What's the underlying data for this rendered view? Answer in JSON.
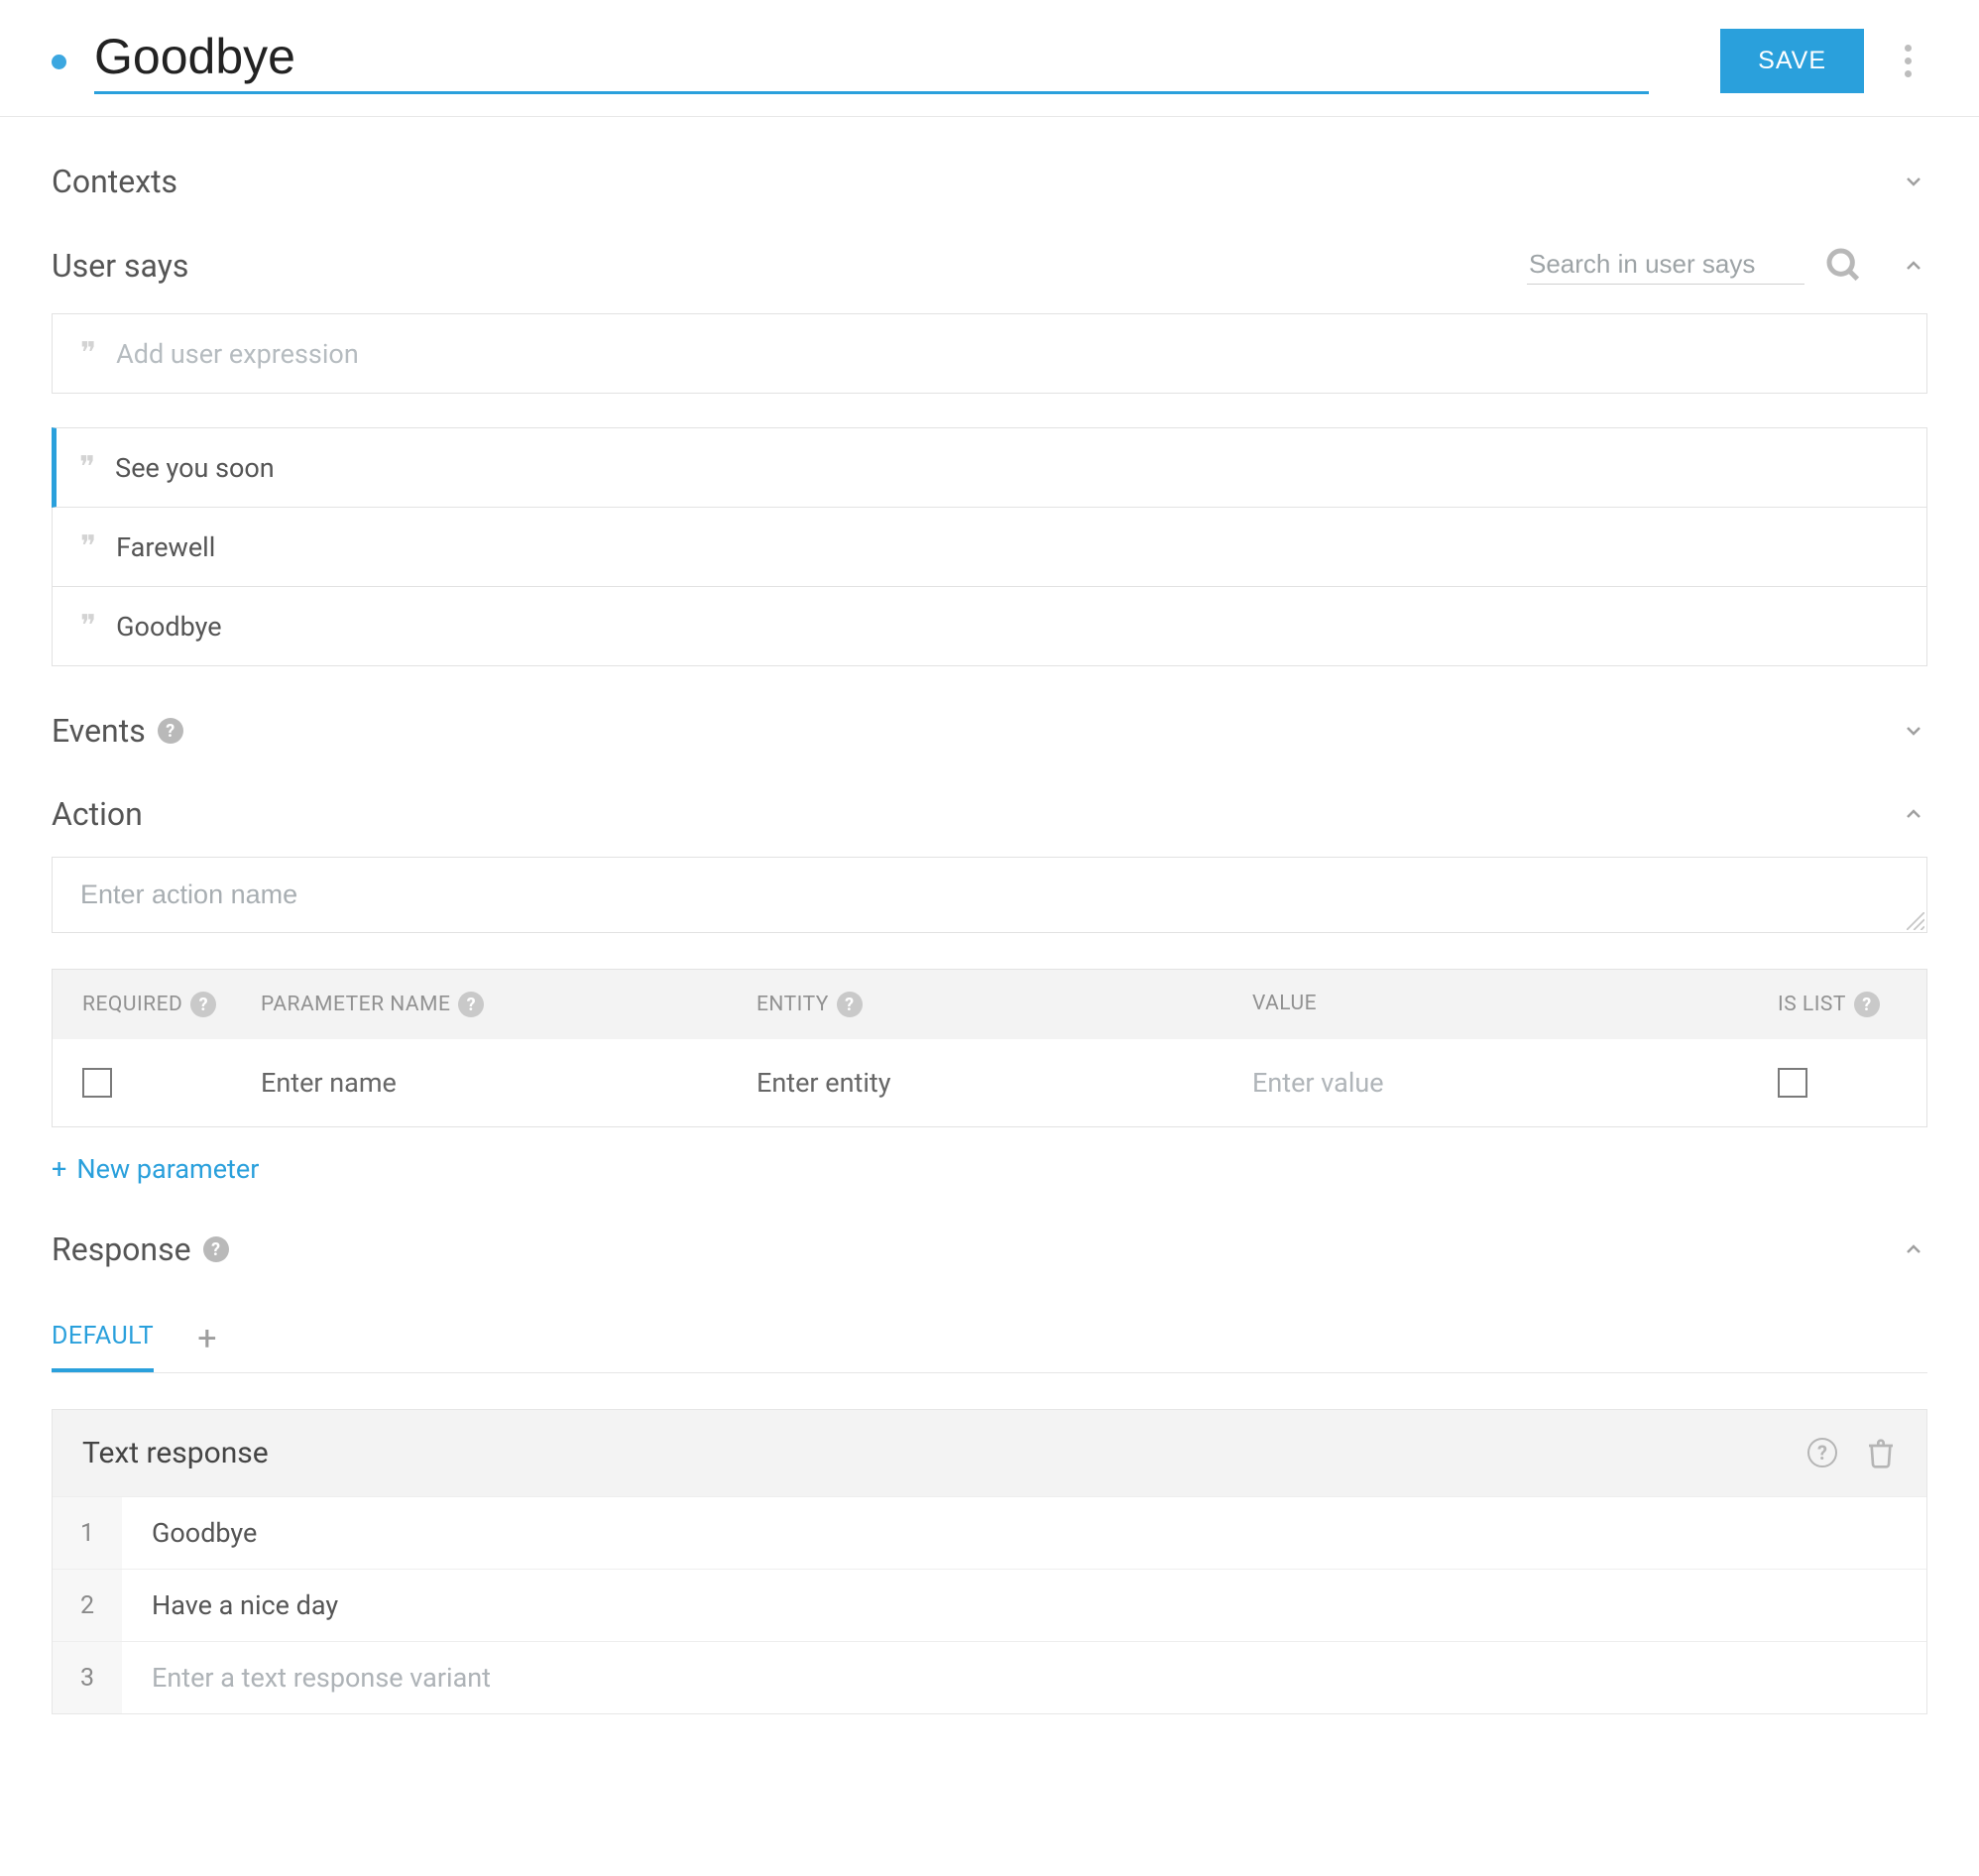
{
  "header": {
    "intent_name": "Goodbye",
    "save_label": "SAVE"
  },
  "sections": {
    "contexts": {
      "title": "Contexts"
    },
    "user_says": {
      "title": "User says",
      "search_placeholder": "Search in user says",
      "add_placeholder": "Add user expression",
      "expressions": [
        "See you soon",
        "Farewell",
        "Goodbye"
      ]
    },
    "events": {
      "title": "Events"
    },
    "action": {
      "title": "Action",
      "name_placeholder": "Enter action name",
      "columns": {
        "required": "REQUIRED",
        "parameter_name": "PARAMETER NAME",
        "entity": "ENTITY",
        "value": "VALUE",
        "is_list": "IS LIST"
      },
      "row_placeholders": {
        "name": "Enter name",
        "entity": "Enter entity",
        "value": "Enter value"
      },
      "new_param_label": "New parameter"
    },
    "response": {
      "title": "Response",
      "tab_default": "DEFAULT",
      "text_response_label": "Text response",
      "variants": [
        "Goodbye",
        "Have a nice day"
      ],
      "variant_placeholder": "Enter a text response variant"
    }
  }
}
